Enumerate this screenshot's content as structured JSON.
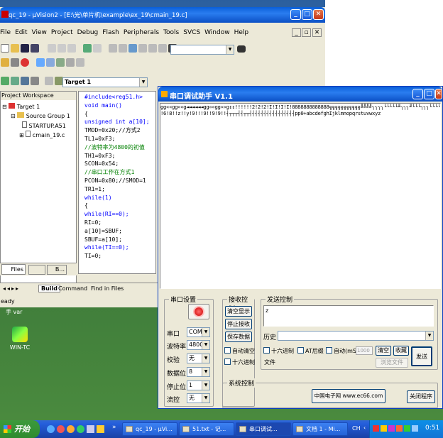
{
  "uv": {
    "title": "qc_19  - µVision2 - [E:\\光\\单片机\\example\\ex_19\\cmain_19.c]",
    "menu": [
      "File",
      "Edit",
      "View",
      "Project",
      "Debug",
      "Flash",
      "Peripherals",
      "Tools",
      "SVCS",
      "Window",
      "Help"
    ],
    "target": "Target 1",
    "workspace": {
      "title": "Project Workspace",
      "target": "Target 1",
      "group": "Source Group 1",
      "files": [
        "STARTUP.A51",
        "cmain_19.c"
      ],
      "tab_files": "Files",
      "tab_b": "B..."
    },
    "code": [
      "#include<reg51.h>",
      "void main()",
      "{",
      "unsigned int a[10];",
      "TMOD=0x20;//方式2",
      "TL1=0xF3;",
      "//波特率为4800的初值",
      "TH1=0xF3;",
      "SCON=0x54;",
      "//串口工作在方式1",
      "PCON=0x80;//SMOD=1",
      "TR1=1;",
      "while(1)",
      "{",
      "while(RI==0);",
      "RI=0;",
      "a[10]=SBUF;",
      "SBUF=a[10];",
      "while(TI==0);",
      "TI=0;"
    ],
    "out_tabs": [
      "Build",
      "Command",
      "Find in Files"
    ],
    "status": "eady"
  },
  "sp": {
    "title": "串口调试助手  V1.1",
    "recv_line1": "gg««gg««g◄◄◄◄◄◄gg««gg««g↕↕!!!!!!2!2!2!I!I!I!I!8888888888888╗╗╗╗╗╗╗╗╗╗╗╝╝╝╝┐┐┐┐└└└└└╜┐┐┐╜└└└┐┐┐└└└└└└└└└└└└┐┐└└└└└┐┐┐┐└└└└└└└┐┐┐┐└└└└└┐┐┐┐┐┐└└└└└└└┐┐┐┐┐┐┐┐┐┐┐┐┐┐┐┐┐┐",
    "recv_line2": "!6!8!!z!!y!9!!!9!!9!9!!┤┬┬┬┤┤┬┬┤┤┤┤┤┤┤┤┤┤┤┤┤┤┤┤pp0+abcdefghIjklmnopqrstuvwxyz",
    "port_group": "串口设置",
    "port_fields": [
      {
        "label": "串口",
        "value": "COM1"
      },
      {
        "label": "波特率",
        "value": "4800"
      },
      {
        "label": "校验",
        "value": "无"
      },
      {
        "label": "数据位",
        "value": "8"
      },
      {
        "label": "停止位",
        "value": "1"
      },
      {
        "label": "流控",
        "value": "无"
      }
    ],
    "recv_group": "接收控制",
    "recv_btns": [
      "清空显示",
      "停止接收",
      "保存数据"
    ],
    "auto_clear": "自动清空",
    "hex_recv": "十六进制",
    "send_group": "发送控制",
    "send_text": "z",
    "history": "历史",
    "hex_send": "十六进制",
    "at_cr": "AT后缀",
    "auto": "自动(mS):",
    "auto_ms": "1000",
    "clear": "清空",
    "collect": "收藏",
    "file": "文件",
    "browse": "浏览文件",
    "send": "发送",
    "sys_group": "系统控制",
    "brand": "中国电子网 www.ec66.com",
    "close": "关闭程序"
  },
  "desktop": {
    "icon1": "手 var",
    "icon2": "WIN-TC"
  },
  "taskbar": {
    "start": "开始",
    "tasks": [
      "qc_19 - µVi...",
      "51.txt - 记...",
      "串口调试...",
      "文档 1 - Mi..."
    ],
    "ime": "CH",
    "clock": "0:51"
  }
}
